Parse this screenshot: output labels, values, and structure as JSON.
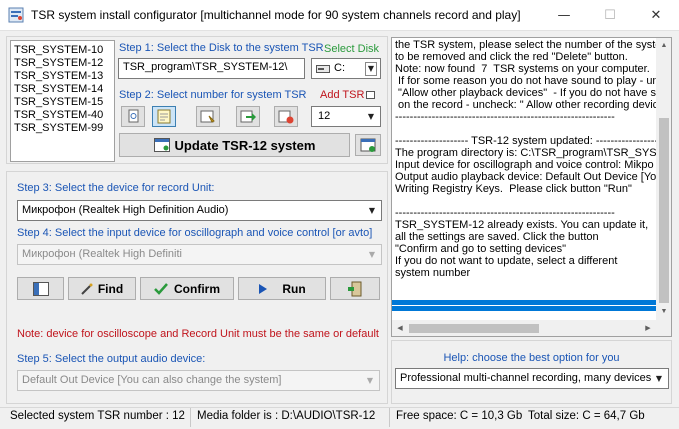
{
  "window": {
    "title": "TSR system install configurator [multichannel mode for 90 system channels  record and play]",
    "minimize_glyph": "—",
    "maximize_glyph": "☐",
    "close_glyph": "✕"
  },
  "systems_list": [
    "TSR_SYSTEM-10",
    "TSR_SYSTEM-12",
    "TSR_SYSTEM-13",
    "TSR_SYSTEM-14",
    "TSR_SYSTEM-15",
    "TSR_SYSTEM-40",
    "TSR_SYSTEM-99"
  ],
  "step1": {
    "label": "Step 1: Select the Disk to the system TSR",
    "select_disk": "Select Disk",
    "path": "TSR_program\\TSR_SYSTEM-12\\",
    "drive": "C:"
  },
  "step2": {
    "label": "Step 2: Select number for system TSR",
    "add_tsr": "Add TSR",
    "number": "12"
  },
  "update_button": "Update TSR-12 system",
  "step3": {
    "label": "Step 3: Select the device for record Unit:",
    "device": "Микрофон (Realtek High Definition Audio)"
  },
  "step4": {
    "label": "Step 4: Select the input device for oscillograph and voice control [or avto]",
    "device": "Микрофон (Realtek High Definiti"
  },
  "actions": {
    "find": "Find",
    "confirm": "Confirm",
    "run": "Run"
  },
  "note": "Note: device for oscilloscope and Record Unit must be the same or default",
  "step5": {
    "label": "Step 5: Select the output audio device:",
    "device": "Default Out Device [You can also change the system]"
  },
  "log_lines": [
    "the TSR system, please select the number of the syste",
    "to be removed and click the red \"Delete\" button.",
    "Note: now found  7  TSR systems on your computer.",
    " If for some reason you do not have sound to play - un",
    " \"Allow other playback devices\"  - If you do not have s",
    " on the record - uncheck: \" Allow other recording devic",
    "------------------------------------------------------------",
    "",
    "-------------------- TSR-12 system updated: ------------------",
    "The program directory is: C:\\TSR_program\\TSR_SYSTEM",
    "Input device for oscillograph and voice control: Mikpo",
    "Output audio playback device: Default Out Device [You",
    "Writing Registry Keys.  Please click button \"Run\"",
    "",
    "------------------------------------------------------------",
    "TSR_SYSTEM-12 already exists. You can update it,",
    "all the settings are saved. Click the button",
    "\"Confirm and go to setting devices\"",
    "If you do not want to update, select a different",
    "system number"
  ],
  "help": {
    "label": "Help: choose the best option for you",
    "option": "Professional multi-channel recording, many devices"
  },
  "status": {
    "selected": "Selected system TSR number : 12",
    "media": "Media folder is : D:\\AUDIO\\TSR-12",
    "free": "Free space: C = 10,3 Gb",
    "total": "Total size: C = 64,7 Gb"
  },
  "colors": {
    "accent_blue": "#1a55b5",
    "accent_green": "#2a9a3c",
    "accent_red": "#c0141c",
    "selection_blue": "#0078d7"
  },
  "icons": [
    "app-icon",
    "file-icon",
    "notepad-icon",
    "folder-icon",
    "arrow-icon",
    "delete-icon",
    "window-icon",
    "checkmark-icon",
    "play-icon",
    "exit-icon",
    "wand-icon",
    "drive-icon"
  ]
}
